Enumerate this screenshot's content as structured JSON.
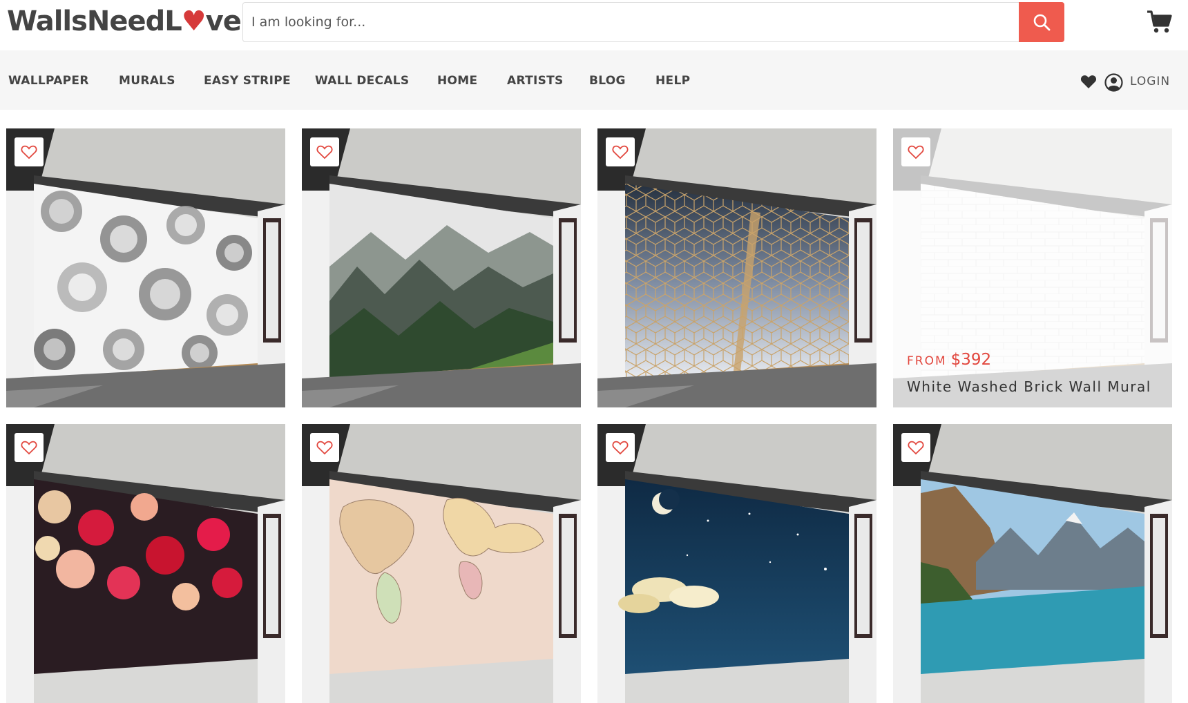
{
  "header": {
    "logo_text": [
      "WallsNeedL",
      "♥",
      "ve"
    ],
    "search_placeholder": "I am looking for...",
    "search_button_icon": "search-icon",
    "cart_icon": "cart-icon"
  },
  "nav": {
    "items": [
      "WALLPAPER",
      "MURALS",
      "EASY STRIPE",
      "WALL DECALS",
      "HOME",
      "ARTISTS",
      "BLOG",
      "HELP"
    ],
    "wishlist_icon": "heart-icon",
    "user_icon": "user-icon",
    "login_label": "LOGIN"
  },
  "products": [
    {
      "art": "grey-peonies",
      "favorite_icon": "heart-outline-icon"
    },
    {
      "art": "misty-forest",
      "favorite_icon": "heart-outline-icon"
    },
    {
      "art": "geometric-cubes",
      "favorite_icon": "heart-outline-icon"
    },
    {
      "art": "white-brick",
      "favorite_icon": "heart-outline-icon",
      "hovered": true,
      "price_prefix": "FROM",
      "price": "$392",
      "title": "White Washed Brick Wall Mural"
    },
    {
      "art": "red-roses",
      "favorite_icon": "heart-outline-icon"
    },
    {
      "art": "world-map",
      "favorite_icon": "heart-outline-icon"
    },
    {
      "art": "night-sky-moon",
      "favorite_icon": "heart-outline-icon"
    },
    {
      "art": "mountain-lake",
      "favorite_icon": "heart-outline-icon"
    }
  ],
  "colors": {
    "accent": "#ef5b4e",
    "price": "#e2473e",
    "nav_bg": "#f6f6f6"
  }
}
